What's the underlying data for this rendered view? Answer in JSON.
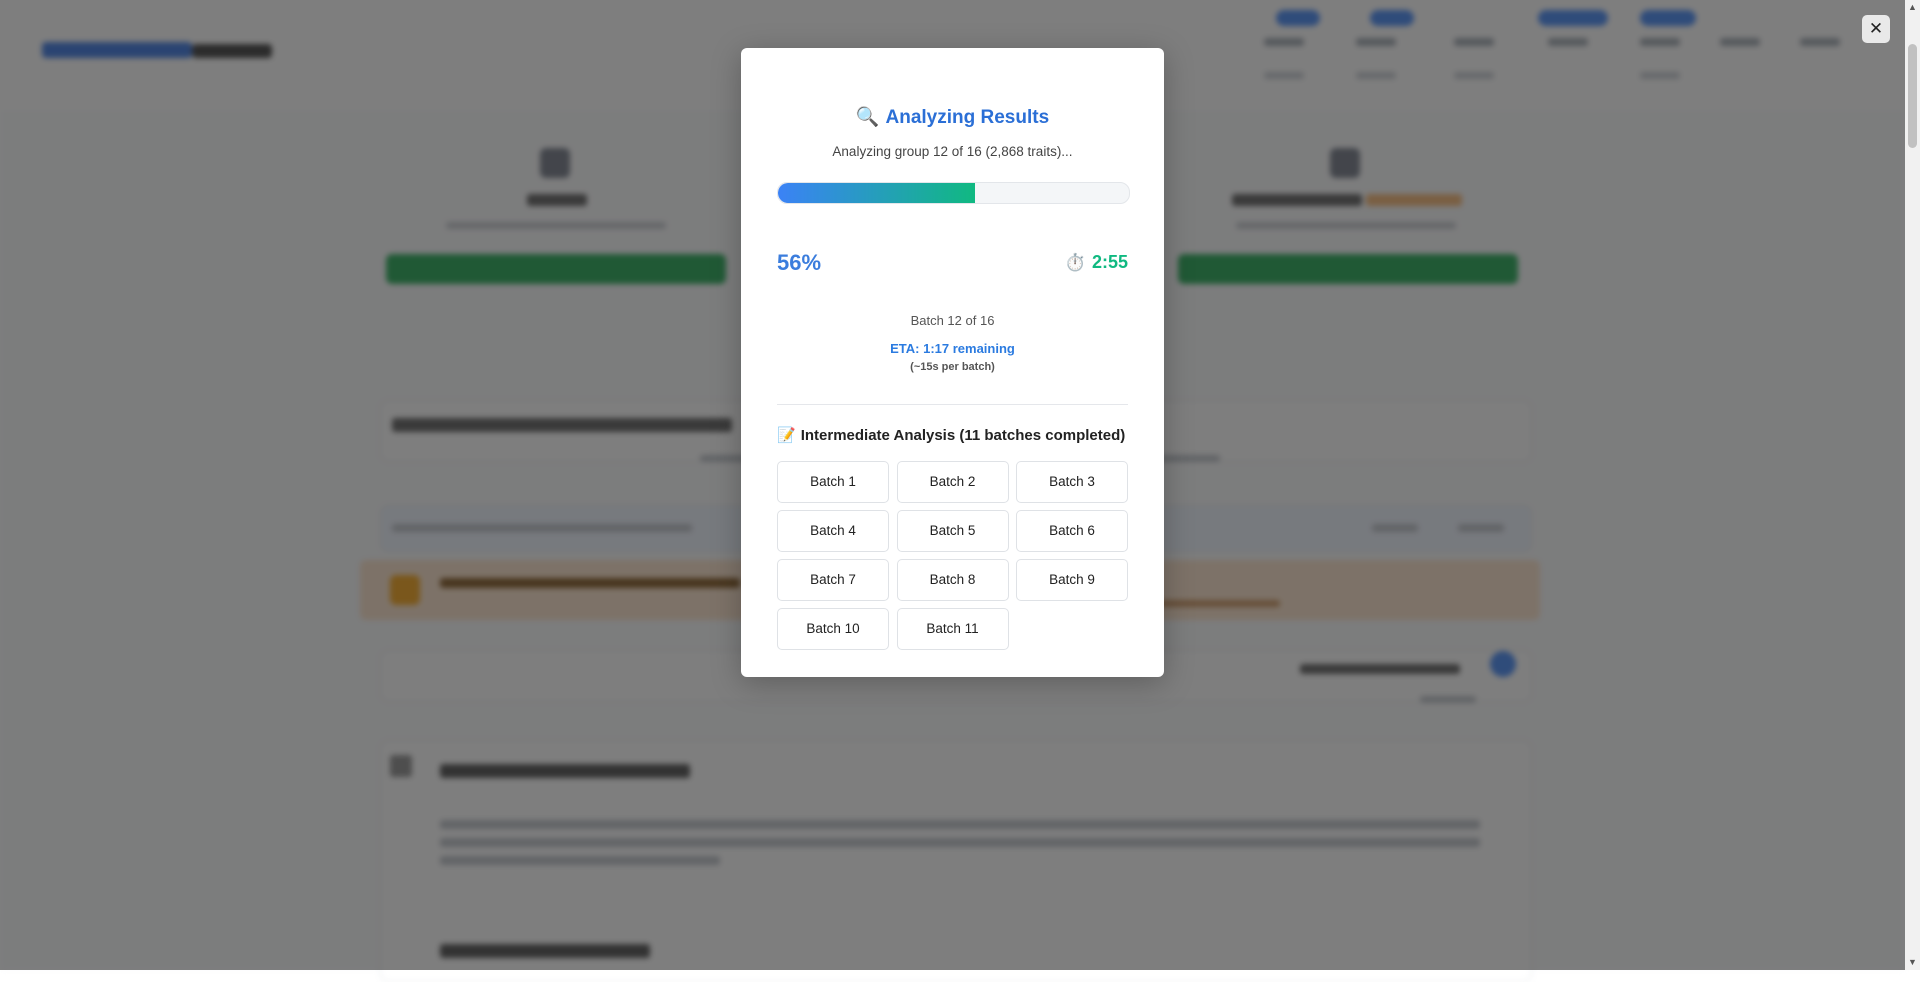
{
  "modal": {
    "title_icon": "🔍",
    "title": "Analyzing Results",
    "subtitle": "Analyzing group 12 of 16 (2,868 traits)...",
    "progress": 0.56,
    "percent_text": "56%",
    "timer_icon": "⏱️",
    "timer_text": "2:55",
    "batch_status": "Batch 12 of 16",
    "eta_text": "ETA: 1:17 remaining",
    "per_batch_text": "(~15s per batch)",
    "intermediate_icon": "📝",
    "intermediate_title": "Intermediate Analysis (11 batches completed)",
    "batches": [
      {
        "label": "Batch 1"
      },
      {
        "label": "Batch 2"
      },
      {
        "label": "Batch 3"
      },
      {
        "label": "Batch 4"
      },
      {
        "label": "Batch 5"
      },
      {
        "label": "Batch 6"
      },
      {
        "label": "Batch 7"
      },
      {
        "label": "Batch 8"
      },
      {
        "label": "Batch 9"
      },
      {
        "label": "Batch 10"
      },
      {
        "label": "Batch 11"
      }
    ]
  },
  "close_button": {
    "label": "✕"
  },
  "colors": {
    "accent_blue": "#2b6fd6",
    "progress_start": "#3b82f6",
    "progress_end": "#10b981",
    "timer_green": "#10b981",
    "overlay": "rgba(40,40,40,0.60)"
  }
}
